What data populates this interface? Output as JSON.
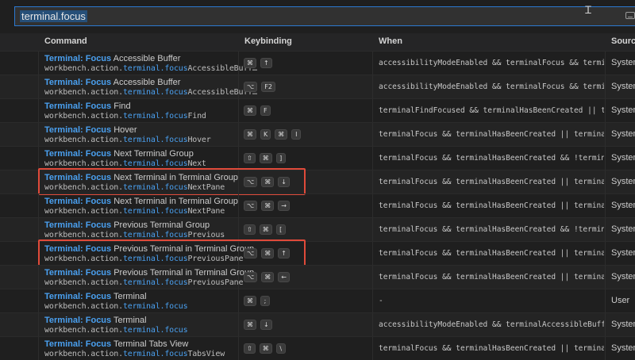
{
  "search": {
    "value": "terminal.focus"
  },
  "columns": {
    "command": "Command",
    "keybinding": "Keybinding",
    "when": "When",
    "source": "Source"
  },
  "rows": [
    {
      "title_prefix": "Terminal: Focus",
      "title_rest": " Accessible Buffer",
      "id_prefix": "workbench.action.",
      "id_match": "terminal.focus",
      "id_rest": "AccessibleBuff…",
      "keys": [
        "⌘",
        "↑"
      ],
      "when": "accessibilityModeEnabled && terminalFocus && terminal…",
      "source": "System"
    },
    {
      "title_prefix": "Terminal: Focus",
      "title_rest": " Accessible Buffer",
      "id_prefix": "workbench.action.",
      "id_match": "terminal.focus",
      "id_rest": "AccessibleBuff…",
      "keys": [
        "⌥",
        "F2"
      ],
      "when": "accessibilityModeEnabled && terminalFocus && terminal…",
      "source": "System"
    },
    {
      "title_prefix": "Terminal: Focus",
      "title_rest": " Find",
      "id_prefix": "workbench.action.",
      "id_match": "terminal.focus",
      "id_rest": "Find",
      "keys": [
        "⌘",
        "F"
      ],
      "when": "terminalFindFocused && terminalHasBeenCreated || term…",
      "source": "System"
    },
    {
      "title_prefix": "Terminal: Focus",
      "title_rest": " Hover",
      "id_prefix": "workbench.action.",
      "id_match": "terminal.focus",
      "id_rest": "Hover",
      "keys": [
        "⌘",
        "K",
        "⌘",
        "I"
      ],
      "when": "terminalFocus && terminalHasBeenCreated || terminalFo…",
      "source": "System"
    },
    {
      "title_prefix": "Terminal: Focus",
      "title_rest": " Next Terminal Group",
      "id_prefix": "workbench.action.",
      "id_match": "terminal.focus",
      "id_rest": "Next",
      "keys": [
        "⇧",
        "⌘",
        "]"
      ],
      "when": "terminalFocus && terminalHasBeenCreated && !terminalE…",
      "source": "System"
    },
    {
      "title_prefix": "Terminal: Focus",
      "title_rest": " Next Terminal in Terminal Group",
      "id_prefix": "workbench.action.",
      "id_match": "terminal.focus",
      "id_rest": "NextPane",
      "keys": [
        "⌥",
        "⌘",
        "↓"
      ],
      "when": "terminalFocus && terminalHasBeenCreated || terminalFo…",
      "source": "System",
      "highlighted": true
    },
    {
      "title_prefix": "Terminal: Focus",
      "title_rest": " Next Terminal in Terminal Group",
      "id_prefix": "workbench.action.",
      "id_match": "terminal.focus",
      "id_rest": "NextPane",
      "keys": [
        "⌥",
        "⌘",
        "→"
      ],
      "when": "terminalFocus && terminalHasBeenCreated || terminalFo…",
      "source": "System"
    },
    {
      "title_prefix": "Terminal: Focus",
      "title_rest": " Previous Terminal Group",
      "id_prefix": "workbench.action.",
      "id_match": "terminal.focus",
      "id_rest": "Previous",
      "keys": [
        "⇧",
        "⌘",
        "["
      ],
      "when": "terminalFocus && terminalHasBeenCreated && !terminalE…",
      "source": "System"
    },
    {
      "title_prefix": "Terminal: Focus",
      "title_rest": " Previous Terminal in Terminal Group",
      "id_prefix": "workbench.action.",
      "id_match": "terminal.focus",
      "id_rest": "PreviousPane",
      "keys": [
        "⌥",
        "⌘",
        "↑"
      ],
      "when": "terminalFocus && terminalHasBeenCreated || terminalFo…",
      "source": "System",
      "highlighted": true
    },
    {
      "title_prefix": "Terminal: Focus",
      "title_rest": " Previous Terminal in Terminal Group",
      "id_prefix": "workbench.action.",
      "id_match": "terminal.focus",
      "id_rest": "PreviousPane",
      "keys": [
        "⌥",
        "⌘",
        "←"
      ],
      "when": "terminalFocus && terminalHasBeenCreated || terminalFo…",
      "source": "System"
    },
    {
      "title_prefix": "Terminal: Focus",
      "title_rest": " Terminal",
      "id_prefix": "workbench.action.",
      "id_match": "terminal.focus",
      "id_rest": "",
      "keys": [
        "⌘",
        ";"
      ],
      "when": "-",
      "source": "User"
    },
    {
      "title_prefix": "Terminal: Focus",
      "title_rest": " Terminal",
      "id_prefix": "workbench.action.",
      "id_match": "terminal.focus",
      "id_rest": "",
      "keys": [
        "⌘",
        "↓"
      ],
      "when": "accessibilityModeEnabled && terminalAccessibleBufferO…",
      "source": "System"
    },
    {
      "title_prefix": "Terminal: Focus",
      "title_rest": " Terminal Tabs View",
      "id_prefix": "workbench.action.",
      "id_match": "terminal.focus",
      "id_rest": "TabsView",
      "keys": [
        "⇧",
        "⌘",
        "\\"
      ],
      "when": "terminalFocus && terminalHasBeenCreated || terminalFo…",
      "source": "System"
    }
  ],
  "colors": {
    "accent": "#4aa0f0",
    "highlight_border": "#e04a3a",
    "search_border": "#2b79d1"
  },
  "icons": {
    "cursor": "text-cursor-icon",
    "keyboard": "keyboard-icon"
  }
}
